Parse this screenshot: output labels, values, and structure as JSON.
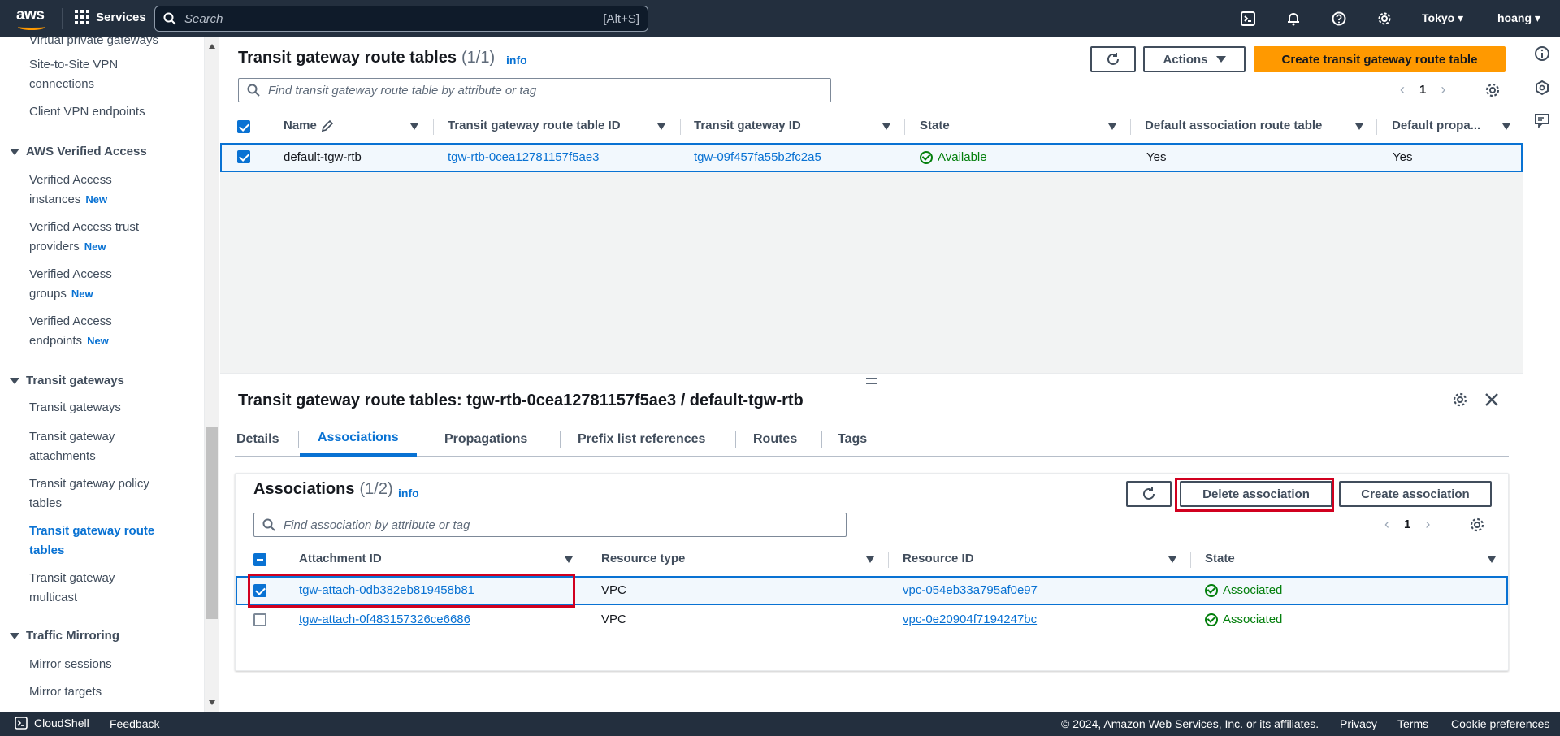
{
  "topnav": {
    "logo_text": "aws",
    "services_label": "Services",
    "search_placeholder": "Search",
    "search_shortcut": "[Alt+S]",
    "region": "Tokyo",
    "user": "hoang"
  },
  "sidebar": {
    "items": [
      {
        "label": "Virtual private gateways"
      },
      {
        "label": "Site-to-Site VPN connections"
      },
      {
        "label": "Client VPN endpoints"
      }
    ],
    "section_verified_access": "AWS Verified Access",
    "verified_access_items": [
      {
        "label": "Verified Access instances",
        "badge": "New"
      },
      {
        "label": "Verified Access trust providers",
        "badge": "New"
      },
      {
        "label": "Verified Access groups",
        "badge": "New"
      },
      {
        "label": "Verified Access endpoints",
        "badge": "New"
      }
    ],
    "section_transit_gateways": "Transit gateways",
    "transit_items": [
      {
        "label": "Transit gateways"
      },
      {
        "label": "Transit gateway attachments"
      },
      {
        "label": "Transit gateway policy tables"
      },
      {
        "label": "Transit gateway route tables"
      },
      {
        "label": "Transit gateway multicast"
      }
    ],
    "section_traffic_mirroring": "Traffic Mirroring",
    "mirroring_items": [
      {
        "label": "Mirror sessions"
      },
      {
        "label": "Mirror targets"
      }
    ]
  },
  "route_tables": {
    "title": "Transit gateway route tables",
    "count": "(1/1)",
    "info": "info",
    "actions_label": "Actions",
    "create_label": "Create transit gateway route table",
    "filter_placeholder": "Find transit gateway route table by attribute or tag",
    "page": "1",
    "columns": [
      "Name",
      "Transit gateway route table ID",
      "Transit gateway ID",
      "State",
      "Default association route table",
      "Default propa..."
    ],
    "rows": [
      {
        "name": "default-tgw-rtb",
        "rtb_id": "tgw-rtb-0cea12781157f5ae3",
        "tgw_id": "tgw-09f457fa55b2fc2a5",
        "state": "Available",
        "default_assoc": "Yes",
        "default_prop": "Yes"
      }
    ]
  },
  "detail": {
    "title": "Transit gateway route tables: tgw-rtb-0cea12781157f5ae3 / default-tgw-rtb",
    "tabs": [
      "Details",
      "Associations",
      "Propagations",
      "Prefix list references",
      "Routes",
      "Tags"
    ],
    "active_tab": "Associations"
  },
  "associations": {
    "title": "Associations",
    "count": "(1/2)",
    "info": "info",
    "delete_label": "Delete association",
    "create_label": "Create association",
    "filter_placeholder": "Find association by attribute or tag",
    "page": "1",
    "columns": [
      "Attachment ID",
      "Resource type",
      "Resource ID",
      "State"
    ],
    "rows": [
      {
        "attachment_id": "tgw-attach-0db382eb819458b81",
        "resource_type": "VPC",
        "resource_id": "vpc-054eb33a795af0e97",
        "state": "Associated",
        "selected": true
      },
      {
        "attachment_id": "tgw-attach-0f483157326ce6686",
        "resource_type": "VPC",
        "resource_id": "vpc-0e20904f7194247bc",
        "state": "Associated",
        "selected": false
      }
    ]
  },
  "footer": {
    "cloudshell": "CloudShell",
    "feedback": "Feedback",
    "copyright": "© 2024, Amazon Web Services, Inc. or its affiliates.",
    "privacy": "Privacy",
    "terms": "Terms",
    "cookies": "Cookie preferences"
  },
  "colors": {
    "nav_bg": "#232f3e",
    "primary_button": "#ff9900",
    "link": "#0972d3",
    "success": "#037f0c",
    "highlight_box": "#d1001f"
  }
}
